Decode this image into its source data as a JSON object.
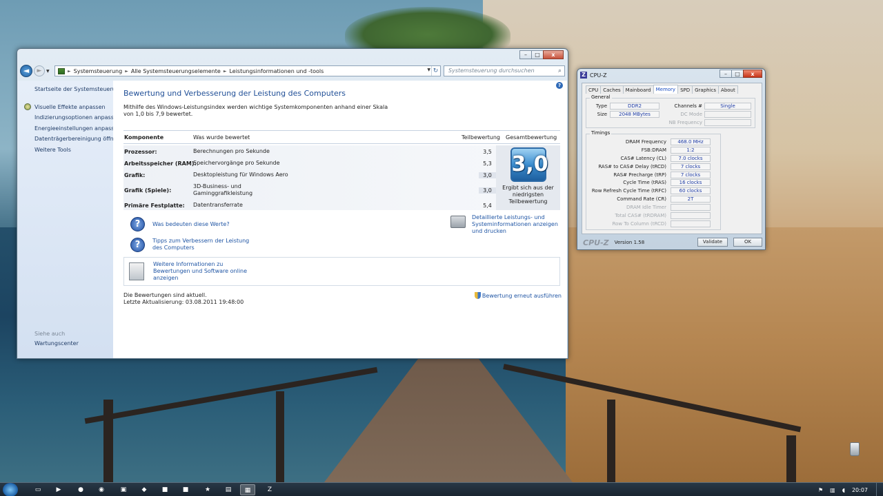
{
  "explorer": {
    "caption_buttons": {
      "minimize": "–",
      "maximize": "□",
      "close": "x"
    },
    "breadcrumb": [
      "Systemsteuerung",
      "Alle Systemsteuerungselemente",
      "Leistungsinformationen und -tools"
    ],
    "search_placeholder": "Systemsteuerung durchsuchen",
    "sidebar": {
      "home": "Startseite der Systemsteuerung",
      "items": [
        "Visuelle Effekte anpassen",
        "Indizierungsoptionen anpassen",
        "Energieeinstellungen anpassen",
        "Datenträgerbereinigung öffnen",
        "Weitere Tools"
      ],
      "see_also": "Siehe auch",
      "action_center": "Wartungscenter"
    },
    "heading": "Bewertung und Verbesserung der Leistung des Computers",
    "intro": "Mithilfe des Windows-Leistungsindex werden wichtige Systemkomponenten anhand einer Skala von 1,0 bis 7,9 bewertet.",
    "table": {
      "headers": {
        "component": "Komponente",
        "rated": "Was wurde bewertet",
        "subscore": "Teilbewertung",
        "base": "Gesamtbewertung"
      },
      "rows": [
        {
          "component": "Prozessor:",
          "rated": "Berechnungen pro Sekunde",
          "score": "3,5"
        },
        {
          "component": "Arbeitsspeicher (RAM):",
          "rated": "Speichervorgänge pro Sekunde",
          "score": "5,3"
        },
        {
          "component": "Grafik:",
          "rated": "Desktopleistung für Windows Aero",
          "score": "3,0"
        },
        {
          "component": "Grafik (Spiele):",
          "rated": "3D-Business- und Gaminggrafikleistung",
          "score": "3,0"
        },
        {
          "component": "Primäre Festplatte:",
          "rated": "Datentransferrate",
          "score": "5,4"
        }
      ],
      "base_score": "3,0",
      "base_note": "Ergibt sich aus der niedrigsten Teilbewertung"
    },
    "links": {
      "meaning": "Was bedeuten diese Werte?",
      "tips": "Tipps zum Verbessern der Leistung des Computers",
      "details": "Detaillierte Leistungs- und Systeminformationen anzeigen und drucken",
      "more_info": "Weitere Informationen zu Bewertungen und Software online anzeigen",
      "rerun": "Bewertung erneut ausführen"
    },
    "status": {
      "line1": "Die Bewertungen sind aktuell.",
      "line2": "Letzte Aktualisierung: 03.08.2011 19:48:00"
    }
  },
  "cpuz": {
    "title": "CPU-Z",
    "logo": "Z",
    "tabs": [
      "CPU",
      "Caches",
      "Mainboard",
      "Memory",
      "SPD",
      "Graphics",
      "About"
    ],
    "active_tab": "Memory",
    "general": {
      "label": "General",
      "type_label": "Type",
      "type": "DDR2",
      "size_label": "Size",
      "size": "2048 MBytes",
      "channels_label": "Channels #",
      "channels": "Single",
      "dc_mode_label": "DC Mode",
      "nb_freq_label": "NB Frequency"
    },
    "timings": {
      "label": "Timings",
      "rows": [
        {
          "label": "DRAM Frequency",
          "value": "468.0 MHz",
          "dim": false
        },
        {
          "label": "FSB:DRAM",
          "value": "1:2",
          "dim": false
        },
        {
          "label": "CAS# Latency (CL)",
          "value": "7.0 clocks",
          "dim": false
        },
        {
          "label": "RAS# to CAS# Delay (tRCD)",
          "value": "7 clocks",
          "dim": false
        },
        {
          "label": "RAS# Precharge (tRP)",
          "value": "7 clocks",
          "dim": false
        },
        {
          "label": "Cycle Time (tRAS)",
          "value": "16 clocks",
          "dim": false
        },
        {
          "label": "Row Refresh Cycle Time (tRFC)",
          "value": "60 clocks",
          "dim": false
        },
        {
          "label": "Command Rate (CR)",
          "value": "2T",
          "dim": false
        },
        {
          "label": "DRAM Idle Timer",
          "value": "",
          "dim": true
        },
        {
          "label": "Total CAS# (tRDRAM)",
          "value": "",
          "dim": true
        },
        {
          "label": "Row To Column (tRCD)",
          "value": "",
          "dim": true
        }
      ]
    },
    "brand": "CPU-Z",
    "version": "Version 1.58",
    "validate": "Validate",
    "ok": "OK"
  },
  "taskbar": {
    "clock": "20:07"
  }
}
